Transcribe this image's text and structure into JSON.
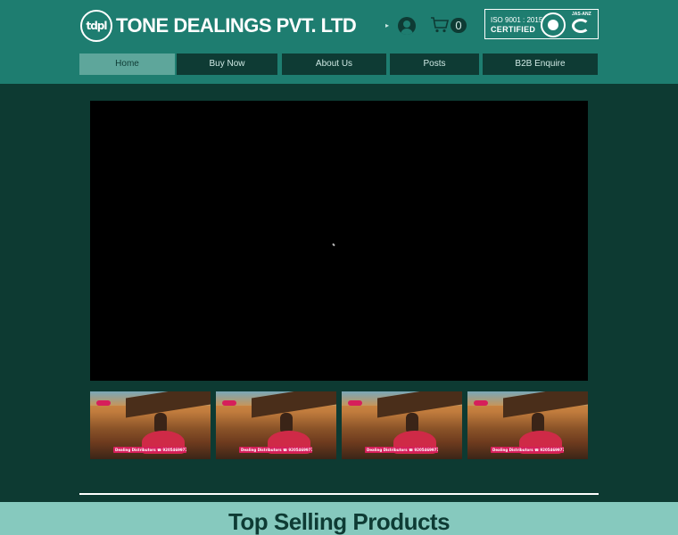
{
  "header": {
    "logo_mark": "tdpl",
    "company_name": "TONE DEALINGS PVT. LTD",
    "cart_count": "0",
    "certification": {
      "standard": "ISO 9001 : 2015",
      "label": "CERTIFIED",
      "accreditation": "JAS-ANZ"
    }
  },
  "nav": {
    "items": [
      {
        "label": "Home",
        "active": true
      },
      {
        "label": "Buy Now",
        "active": false
      },
      {
        "label": "About Us",
        "active": false
      },
      {
        "label": "Posts",
        "active": false
      },
      {
        "label": "B2B Enquire",
        "active": false
      }
    ]
  },
  "thumbnails": [
    {
      "caption": "Dealing Distributors  ☎ 9205469977"
    },
    {
      "caption": "Dealing Distributors  ☎ 9205469977"
    },
    {
      "caption": "Dealing Distributors  ☎ 9205469977"
    },
    {
      "caption": "Dealing Distributors  ☎ 9205469977"
    }
  ],
  "section": {
    "title": "Top Selling Products"
  },
  "colors": {
    "header": "#1e7d70",
    "page": "#0d3a32",
    "nav": "#0e3b34",
    "nav_active": "#5ea69b",
    "section": "#86c9be"
  }
}
